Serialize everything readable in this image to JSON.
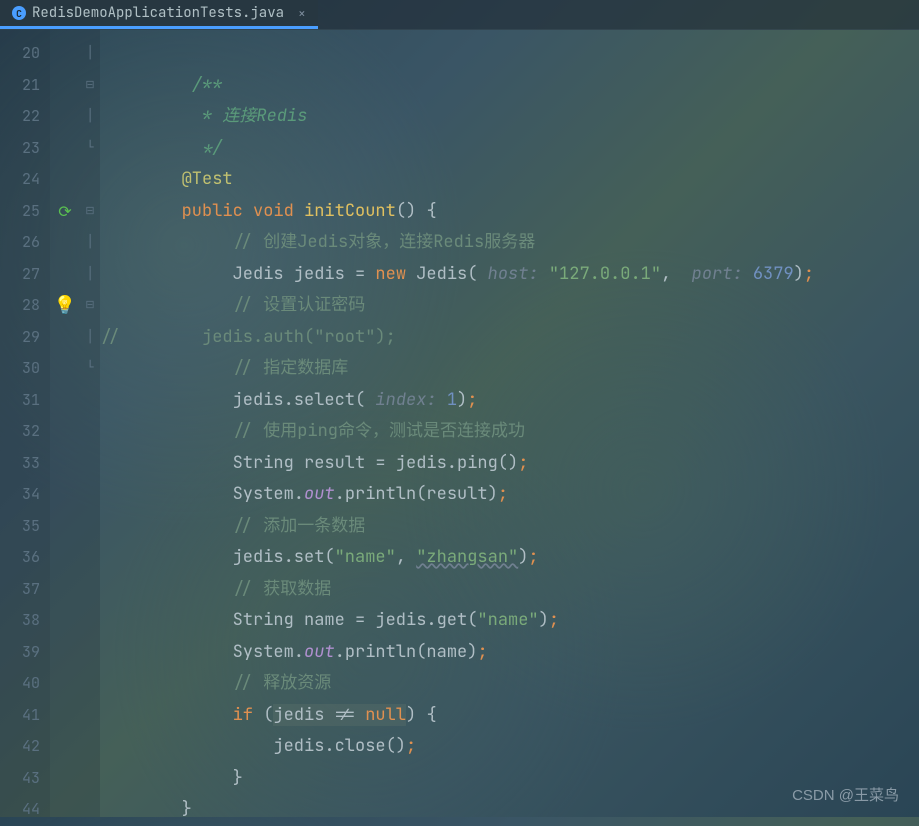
{
  "tab": {
    "filename": "RedisDemoApplicationTests.java",
    "icon_letter": "C"
  },
  "gutter": {
    "lines": [
      "20",
      "21",
      "22",
      "23",
      "24",
      "25",
      "26",
      "27",
      "28",
      "29",
      "30",
      "31",
      "32",
      "33",
      "34",
      "35",
      "36",
      "37",
      "38",
      "39",
      "40",
      "41",
      "42",
      "43",
      "44"
    ]
  },
  "code": {
    "l21": "/**",
    "l22": " * 连接Redis",
    "l23": " */",
    "l24": "@Test",
    "l25_kw1": "public",
    "l25_kw2": "void",
    "l25_method": "initCount",
    "l25_paren": "() {",
    "l26": "// 创建Jedis对象，连接Redis服务器",
    "l27_type": "Jedis jedis = ",
    "l27_new": "new",
    "l27_class": " Jedis(",
    "l27_hint1": " host: ",
    "l27_str1": "\"127.0.0.1\"",
    "l27_comma": ", ",
    "l27_hint2": " port: ",
    "l27_num": "6379",
    "l27_end": ")",
    "l28": "// 设置认证密码",
    "l29_cmt": "//",
    "l29_code": "        jedis.auth(\"root\");",
    "l30": "// 指定数据库",
    "l31_a": "jedis.select(",
    "l31_hint": " index: ",
    "l31_num": "1",
    "l31_end": ")",
    "l32": "// 使用ping命令，测试是否连接成功",
    "l33": "String result = jedis.ping()",
    "l34_a": "System.",
    "l34_out": "out",
    "l34_b": ".println(result)",
    "l35": "// 添加一条数据",
    "l36_a": "jedis.set(",
    "l36_s1": "\"name\"",
    "l36_c": ", ",
    "l36_s2": "\"zhangsan\"",
    "l36_end": ")",
    "l37": "// 获取数据",
    "l38_a": "String name = jedis.get(",
    "l38_s": "\"name\"",
    "l38_end": ")",
    "l39_a": "System.",
    "l39_out": "out",
    "l39_b": ".println(name)",
    "l40": "// 释放资源",
    "l41_if": "if",
    "l41_a": " (",
    "l41_cond": "jedis != ",
    "l41_null": "null",
    "l41_end": ") {",
    "l42": "jedis.close()",
    "l43": "}",
    "l44": "}"
  },
  "watermark": "CSDN @王菜鸟"
}
